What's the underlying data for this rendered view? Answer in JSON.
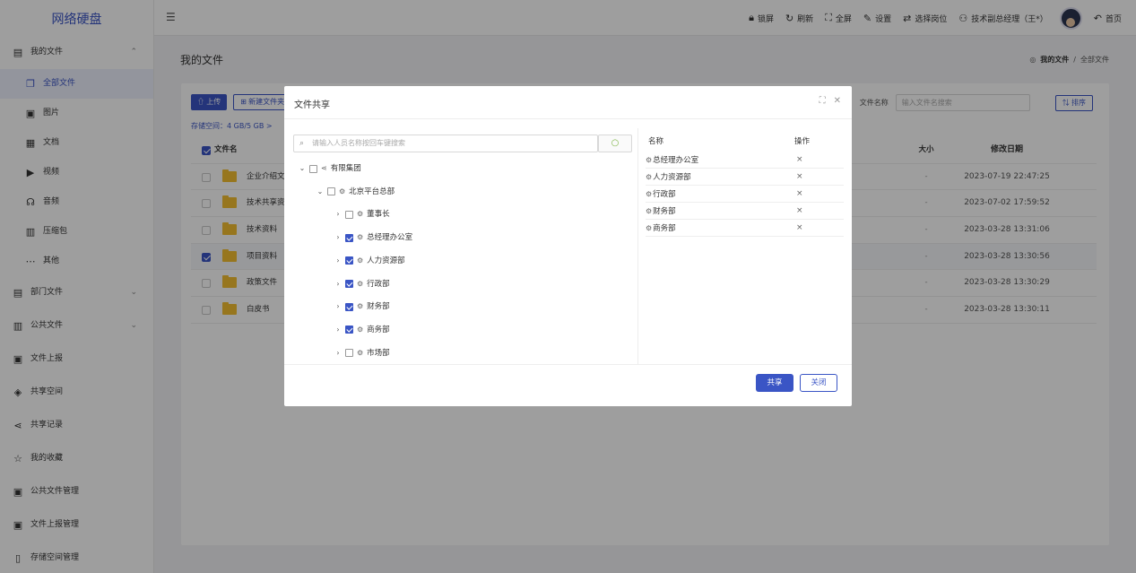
{
  "app": {
    "title": "网络硬盘"
  },
  "sidebar": {
    "items": [
      {
        "label": "我的文件",
        "icon": "file-icon",
        "caret": "⌃"
      },
      {
        "label": "全部文件",
        "icon": "files-icon",
        "active": true
      },
      {
        "label": "图片",
        "icon": "image-icon"
      },
      {
        "label": "文档",
        "icon": "document-icon"
      },
      {
        "label": "视频",
        "icon": "video-icon"
      },
      {
        "label": "音频",
        "icon": "headphones-icon"
      },
      {
        "label": "压缩包",
        "icon": "archive-icon"
      },
      {
        "label": "其他",
        "icon": "more-icon"
      },
      {
        "label": "部门文件",
        "icon": "folder-icon",
        "caret": "⌄"
      },
      {
        "label": "公共文件",
        "icon": "building-icon",
        "caret": "⌄"
      },
      {
        "label": "文件上报",
        "icon": "upload-report-icon"
      },
      {
        "label": "共享空间",
        "icon": "cube-icon"
      },
      {
        "label": "共享记录",
        "icon": "share-icon"
      },
      {
        "label": "我的收藏",
        "icon": "star-icon"
      },
      {
        "label": "公共文件管理",
        "icon": "manage-icon"
      },
      {
        "label": "文件上报管理",
        "icon": "manage-icon"
      },
      {
        "label": "存储空间管理",
        "icon": "storage-icon"
      }
    ]
  },
  "topbar": {
    "lock": "锁屏",
    "refresh": "刷新",
    "fullscreen": "全屏",
    "settings": "设置",
    "switch_role": "选择岗位",
    "user": "技术副总经理（王*）",
    "home": "首页"
  },
  "main": {
    "title": "我的文件",
    "breadcrumb": {
      "current": "我的文件",
      "sep": "/",
      "leaf": "全部文件"
    },
    "upload_label": "上传",
    "new_folder_label": "新建文件夹",
    "storage": "存储空间：4 GB/5 GB >",
    "search_label": "文件名称",
    "search_placeholder": "输入文件名搜索",
    "sort_label": "排序",
    "columns": {
      "name": "文件名",
      "size": "大小",
      "date": "修改日期"
    },
    "rows": [
      {
        "name": "企业介绍文档",
        "size": "-",
        "date": "2023-07-19 22:47:25",
        "checked": false
      },
      {
        "name": "技术共享资料",
        "size": "-",
        "date": "2023-07-02 17:59:52",
        "checked": false
      },
      {
        "name": "技术资料",
        "size": "-",
        "date": "2023-03-28 13:31:06",
        "checked": false
      },
      {
        "name": "项目资料",
        "size": "-",
        "date": "2023-03-28 13:30:56",
        "checked": true
      },
      {
        "name": "政策文件",
        "size": "-",
        "date": "2023-03-28 13:30:29",
        "checked": false
      },
      {
        "name": "白皮书",
        "size": "-",
        "date": "2023-03-28 13:30:11",
        "checked": false
      }
    ]
  },
  "modal": {
    "title": "文件共享",
    "search_placeholder": "请输入人员名称按回车键搜索",
    "tree": [
      {
        "label": "有限集团",
        "level": 0,
        "arrow": "⌄",
        "checked": false,
        "icon": "group-icon"
      },
      {
        "label": "北京平台总部",
        "level": 1,
        "arrow": "⌄",
        "checked": false,
        "icon": "dept-icon"
      },
      {
        "label": "董事长",
        "level": 2,
        "arrow": "›",
        "checked": false,
        "icon": "dept-icon"
      },
      {
        "label": "总经理办公室",
        "level": 2,
        "arrow": "›",
        "checked": true,
        "icon": "dept-icon"
      },
      {
        "label": "人力资源部",
        "level": 2,
        "arrow": "›",
        "checked": true,
        "icon": "dept-icon"
      },
      {
        "label": "行政部",
        "level": 2,
        "arrow": "›",
        "checked": true,
        "icon": "dept-icon"
      },
      {
        "label": "财务部",
        "level": 2,
        "arrow": "›",
        "checked": true,
        "icon": "dept-icon"
      },
      {
        "label": "商务部",
        "level": 2,
        "arrow": "›",
        "checked": true,
        "icon": "dept-icon"
      },
      {
        "label": "市场部",
        "level": 2,
        "arrow": "›",
        "checked": false,
        "icon": "dept-icon"
      }
    ],
    "selected_header": {
      "name": "名称",
      "action": "操作"
    },
    "selected": [
      "总经理办公室",
      "人力资源部",
      "行政部",
      "财务部",
      "商务部"
    ],
    "remove_glyph": "×",
    "share_label": "共享",
    "close_label": "关闭"
  },
  "colors": {
    "accent": "#3a55c5",
    "folder": "#f4bf31"
  }
}
